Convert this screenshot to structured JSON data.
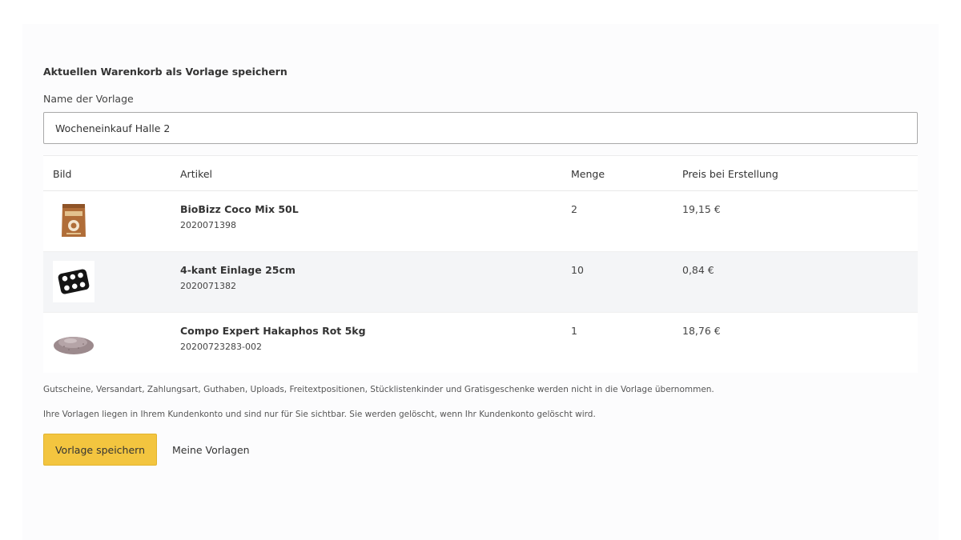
{
  "form": {
    "section_title": "Aktuellen Warenkorb als Vorlage speichern",
    "name_label": "Name der Vorlage",
    "name_value": "Wocheneinkauf Halle 2"
  },
  "table": {
    "headers": {
      "image": "Bild",
      "article": "Artikel",
      "quantity": "Menge",
      "price": "Preis bei Erstellung"
    },
    "rows": [
      {
        "name": "BioBizz Coco Mix 50L",
        "article_no": "2020071398",
        "quantity": "2",
        "price": "19,15 €",
        "image_icon": "soil-bag-icon"
      },
      {
        "name": "4-kant Einlage 25cm",
        "article_no": "2020071382",
        "quantity": "10",
        "price": "0,84 €",
        "image_icon": "grid-insert-icon"
      },
      {
        "name": "Compo Expert Hakaphos Rot 5kg",
        "article_no": "20200723283-002",
        "quantity": "1",
        "price": "18,76 €",
        "image_icon": "fertilizer-pile-icon"
      }
    ]
  },
  "notes": {
    "excluded": "Gutscheine, Versandart, Zahlungsart, Guthaben, Uploads, Freitextpositionen, Stücklistenkinder und Gratisgeschenke werden nicht in die Vorlage übernommen.",
    "privacy": "Ihre Vorlagen liegen in Ihrem Kundenkonto und sind nur für Sie sichtbar. Sie werden gelöscht, wenn Ihr Kundenkonto gelöscht wird."
  },
  "actions": {
    "save_label": "Vorlage speichern",
    "my_templates_label": "Meine Vorlagen"
  },
  "colors": {
    "primary_button": "#f3c53f",
    "zebra_row": "#f4f5f7"
  }
}
